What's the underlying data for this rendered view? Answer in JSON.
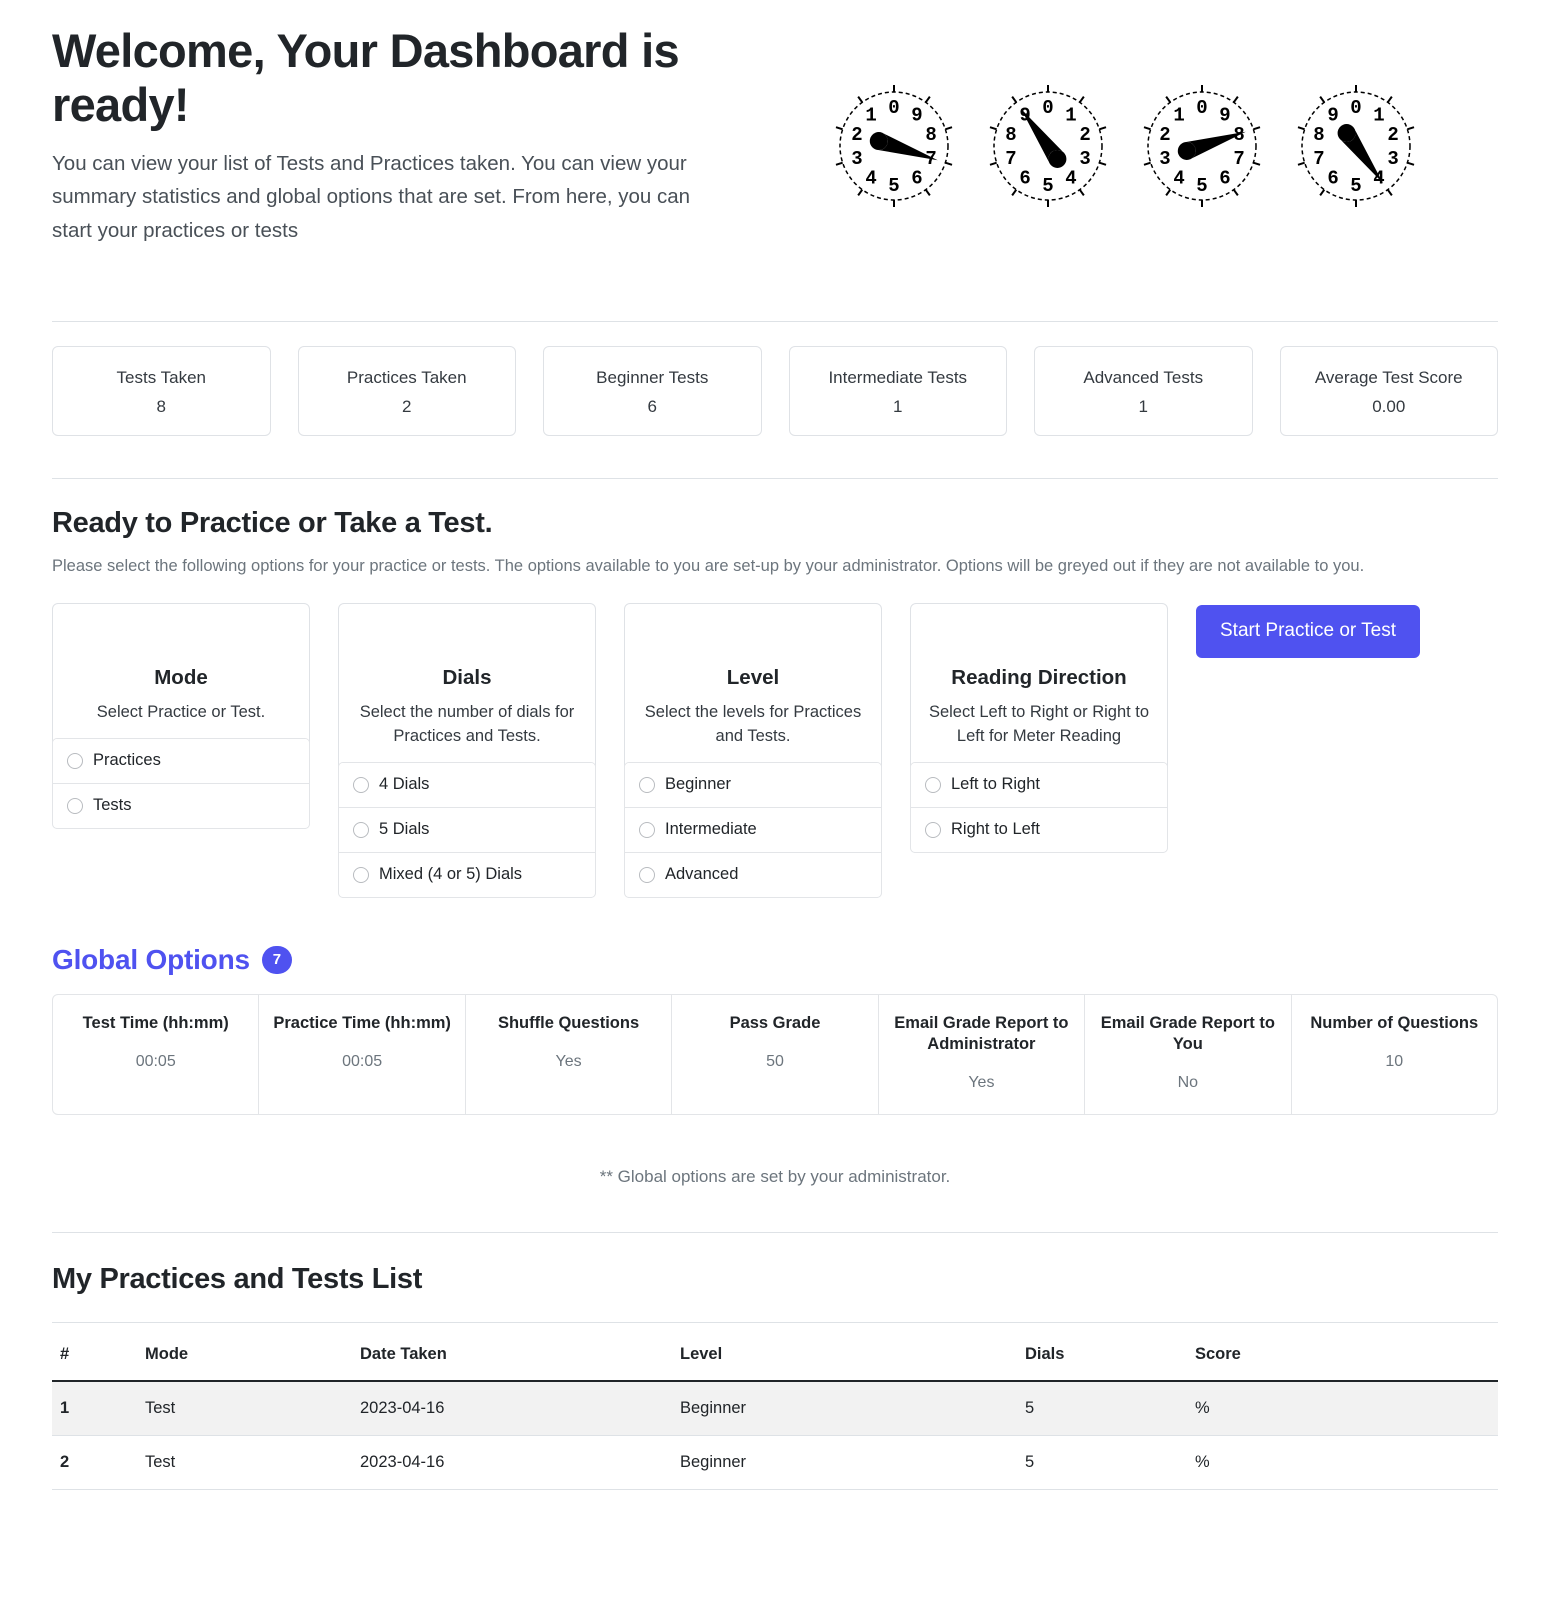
{
  "hero": {
    "title": "Welcome, Your Dashboard is ready!",
    "subtitle": "You can view your list of Tests and Practices taken. You can view your summary statistics and global options that are set. From here, you can start your practices or tests",
    "meters": [
      {
        "name": "dial-1",
        "direction": "counter-clockwise",
        "value": 7
      },
      {
        "name": "dial-2",
        "direction": "clockwise",
        "value": 9
      },
      {
        "name": "dial-3",
        "direction": "counter-clockwise",
        "value": 8
      },
      {
        "name": "dial-4",
        "direction": "clockwise",
        "value": 4
      }
    ]
  },
  "stats": [
    {
      "label": "Tests Taken",
      "value": "8"
    },
    {
      "label": "Practices Taken",
      "value": "2"
    },
    {
      "label": "Beginner Tests",
      "value": "6"
    },
    {
      "label": "Intermediate Tests",
      "value": "1"
    },
    {
      "label": "Advanced Tests",
      "value": "1"
    },
    {
      "label": "Average Test Score",
      "value": "0.00"
    }
  ],
  "ready": {
    "title": "Ready to Practice or Take a Test.",
    "description": "Please select the following options for your practice or tests. The options available to you are set-up by your administrator. Options will be greyed out if they are not available to you.",
    "start_button": "Start Practice or Test",
    "cards": [
      {
        "title": "Mode",
        "text": "Select Practice or Test.",
        "options": [
          "Practices",
          "Tests"
        ]
      },
      {
        "title": "Dials",
        "text": "Select the number of dials for Practices and Tests.",
        "options": [
          "4 Dials",
          "5 Dials",
          "Mixed (4 or 5) Dials"
        ]
      },
      {
        "title": "Level",
        "text": "Select the levels for Practices and Tests.",
        "options": [
          "Beginner",
          "Intermediate",
          "Advanced"
        ]
      },
      {
        "title": "Reading Direction",
        "text": "Select Left to Right or Right to Left for Meter Reading",
        "options": [
          "Left to Right",
          "Right to Left"
        ]
      }
    ]
  },
  "global_options": {
    "title": "Global Options",
    "count": "7",
    "note": "** Global options are set by your administrator.",
    "items": [
      {
        "label": "Test Time (hh:mm)",
        "value": "00:05"
      },
      {
        "label": "Practice Time (hh:mm)",
        "value": "00:05"
      },
      {
        "label": "Shuffle Questions",
        "value": "Yes"
      },
      {
        "label": "Pass Grade",
        "value": "50"
      },
      {
        "label": "Email Grade Report to Administrator",
        "value": "Yes"
      },
      {
        "label": "Email Grade Report to You",
        "value": "No"
      },
      {
        "label": "Number of Questions",
        "value": "10"
      }
    ]
  },
  "list": {
    "title": "My Practices and Tests List",
    "columns": [
      "#",
      "Mode",
      "Date Taken",
      "Level",
      "Dials",
      "Score"
    ],
    "rows": [
      {
        "num": "1",
        "mode": "Test",
        "date": "2023-04-16",
        "level": "Beginner",
        "dials": "5",
        "score": "%"
      },
      {
        "num": "2",
        "mode": "Test",
        "date": "2023-04-16",
        "level": "Beginner",
        "dials": "5",
        "score": "%"
      }
    ]
  },
  "colors": {
    "accent": "#4f52f0",
    "text": "#212529",
    "muted": "#6c757d",
    "border": "#dee2e6",
    "stripe": "#f2f2f2"
  }
}
